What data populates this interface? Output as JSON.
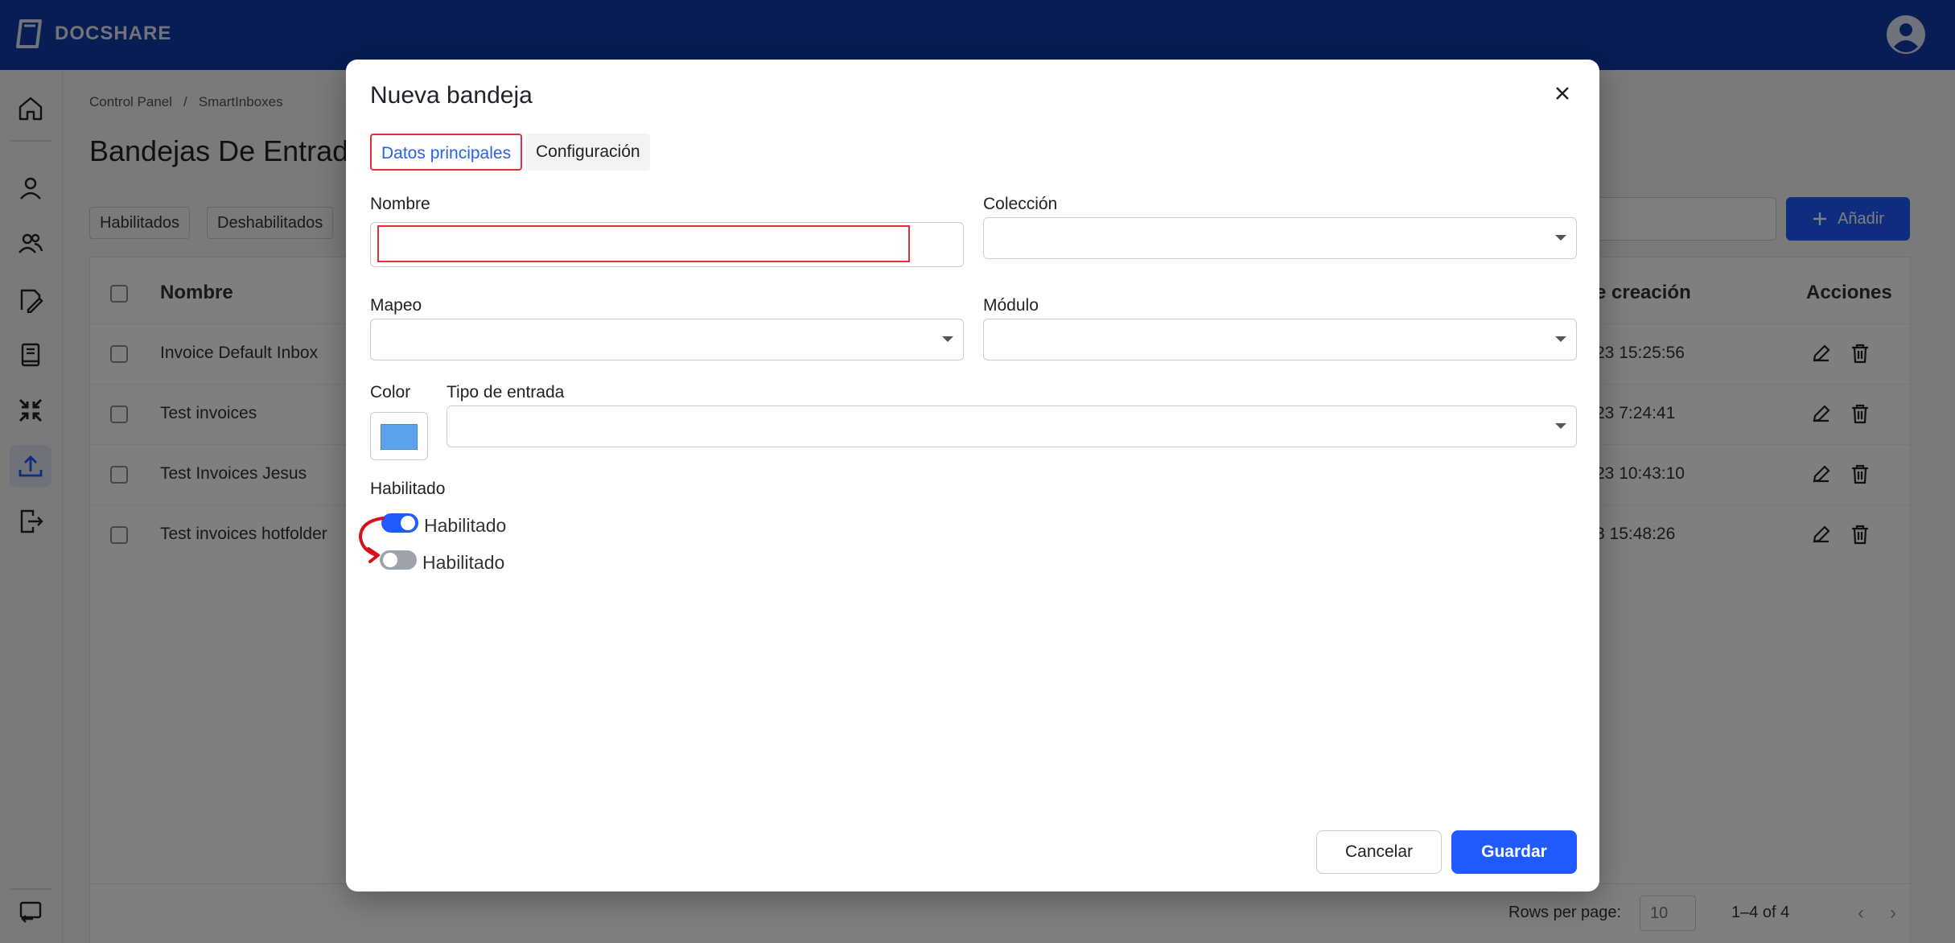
{
  "app": {
    "name": "DOCSHARE"
  },
  "breadcrumb": [
    "Control Panel",
    "/",
    "SmartInboxes"
  ],
  "page": {
    "title": "Bandejas De Entrad"
  },
  "filters": [
    "Habilitados",
    "Deshabilitados"
  ],
  "add_button": {
    "label": "Añadir"
  },
  "table": {
    "headers": {
      "name": "Nombre",
      "created": "e creación",
      "actions": "Acciones"
    },
    "rows": [
      {
        "name": "Invoice Default Inbox",
        "date": "23 15:25:56"
      },
      {
        "name": "Test invoices",
        "date": "23 7:24:41"
      },
      {
        "name": "Test Invoices Jesus",
        "date": "23 10:43:10"
      },
      {
        "name": "Test invoices hotfolder",
        "date": "3 15:48:26"
      }
    ],
    "footer": {
      "rows_per_page_label": "Rows per page:",
      "rows_per_page_value": "10",
      "count": "1–4 of 4"
    }
  },
  "modal": {
    "title": "Nueva bandeja",
    "tabs": [
      {
        "label": "Datos principales",
        "active": true
      },
      {
        "label": "Configuración",
        "active": false
      }
    ],
    "fields": {
      "nombre": {
        "label": "Nombre",
        "value": ""
      },
      "coleccion": {
        "label": "Colección",
        "value": ""
      },
      "mapeo": {
        "label": "Mapeo",
        "value": ""
      },
      "modulo": {
        "label": "Módulo",
        "value": ""
      },
      "color": {
        "label": "Color",
        "value": "#5aa3ec"
      },
      "tipo_entrada": {
        "label": "Tipo de entrada",
        "value": ""
      }
    },
    "habilitado": {
      "section_label": "Habilitado",
      "toggle_on_label": "Habilitado",
      "toggle_off_label": "Habilitado"
    },
    "buttons": {
      "cancel": "Cancelar",
      "save": "Guardar"
    }
  },
  "colors": {
    "brand": "#0e3aa6",
    "primary": "#1f5bff",
    "highlight": "#e0303a"
  },
  "icons": [
    "home-icon",
    "user-icon",
    "users-icon",
    "document-sign-icon",
    "book-icon",
    "compress-icon",
    "upload-icon",
    "logout-icon",
    "switch-icon"
  ]
}
